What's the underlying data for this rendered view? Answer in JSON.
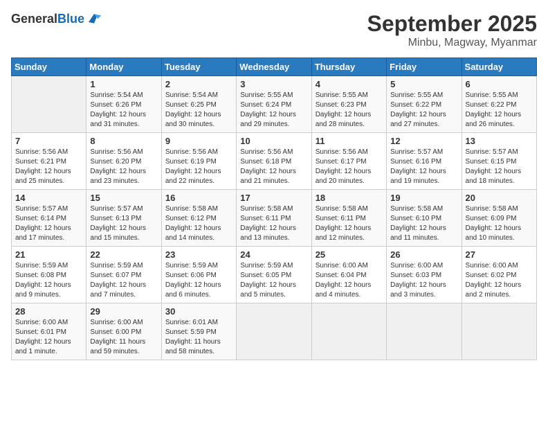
{
  "logo": {
    "general": "General",
    "blue": "Blue"
  },
  "title": "September 2025",
  "location": "Minbu, Magway, Myanmar",
  "weekdays": [
    "Sunday",
    "Monday",
    "Tuesday",
    "Wednesday",
    "Thursday",
    "Friday",
    "Saturday"
  ],
  "weeks": [
    [
      {
        "day": "",
        "info": ""
      },
      {
        "day": "1",
        "info": "Sunrise: 5:54 AM\nSunset: 6:26 PM\nDaylight: 12 hours\nand 31 minutes."
      },
      {
        "day": "2",
        "info": "Sunrise: 5:54 AM\nSunset: 6:25 PM\nDaylight: 12 hours\nand 30 minutes."
      },
      {
        "day": "3",
        "info": "Sunrise: 5:55 AM\nSunset: 6:24 PM\nDaylight: 12 hours\nand 29 minutes."
      },
      {
        "day": "4",
        "info": "Sunrise: 5:55 AM\nSunset: 6:23 PM\nDaylight: 12 hours\nand 28 minutes."
      },
      {
        "day": "5",
        "info": "Sunrise: 5:55 AM\nSunset: 6:22 PM\nDaylight: 12 hours\nand 27 minutes."
      },
      {
        "day": "6",
        "info": "Sunrise: 5:55 AM\nSunset: 6:22 PM\nDaylight: 12 hours\nand 26 minutes."
      }
    ],
    [
      {
        "day": "7",
        "info": "Sunrise: 5:56 AM\nSunset: 6:21 PM\nDaylight: 12 hours\nand 25 minutes."
      },
      {
        "day": "8",
        "info": "Sunrise: 5:56 AM\nSunset: 6:20 PM\nDaylight: 12 hours\nand 23 minutes."
      },
      {
        "day": "9",
        "info": "Sunrise: 5:56 AM\nSunset: 6:19 PM\nDaylight: 12 hours\nand 22 minutes."
      },
      {
        "day": "10",
        "info": "Sunrise: 5:56 AM\nSunset: 6:18 PM\nDaylight: 12 hours\nand 21 minutes."
      },
      {
        "day": "11",
        "info": "Sunrise: 5:56 AM\nSunset: 6:17 PM\nDaylight: 12 hours\nand 20 minutes."
      },
      {
        "day": "12",
        "info": "Sunrise: 5:57 AM\nSunset: 6:16 PM\nDaylight: 12 hours\nand 19 minutes."
      },
      {
        "day": "13",
        "info": "Sunrise: 5:57 AM\nSunset: 6:15 PM\nDaylight: 12 hours\nand 18 minutes."
      }
    ],
    [
      {
        "day": "14",
        "info": "Sunrise: 5:57 AM\nSunset: 6:14 PM\nDaylight: 12 hours\nand 17 minutes."
      },
      {
        "day": "15",
        "info": "Sunrise: 5:57 AM\nSunset: 6:13 PM\nDaylight: 12 hours\nand 15 minutes."
      },
      {
        "day": "16",
        "info": "Sunrise: 5:58 AM\nSunset: 6:12 PM\nDaylight: 12 hours\nand 14 minutes."
      },
      {
        "day": "17",
        "info": "Sunrise: 5:58 AM\nSunset: 6:11 PM\nDaylight: 12 hours\nand 13 minutes."
      },
      {
        "day": "18",
        "info": "Sunrise: 5:58 AM\nSunset: 6:11 PM\nDaylight: 12 hours\nand 12 minutes."
      },
      {
        "day": "19",
        "info": "Sunrise: 5:58 AM\nSunset: 6:10 PM\nDaylight: 12 hours\nand 11 minutes."
      },
      {
        "day": "20",
        "info": "Sunrise: 5:58 AM\nSunset: 6:09 PM\nDaylight: 12 hours\nand 10 minutes."
      }
    ],
    [
      {
        "day": "21",
        "info": "Sunrise: 5:59 AM\nSunset: 6:08 PM\nDaylight: 12 hours\nand 9 minutes."
      },
      {
        "day": "22",
        "info": "Sunrise: 5:59 AM\nSunset: 6:07 PM\nDaylight: 12 hours\nand 7 minutes."
      },
      {
        "day": "23",
        "info": "Sunrise: 5:59 AM\nSunset: 6:06 PM\nDaylight: 12 hours\nand 6 minutes."
      },
      {
        "day": "24",
        "info": "Sunrise: 5:59 AM\nSunset: 6:05 PM\nDaylight: 12 hours\nand 5 minutes."
      },
      {
        "day": "25",
        "info": "Sunrise: 6:00 AM\nSunset: 6:04 PM\nDaylight: 12 hours\nand 4 minutes."
      },
      {
        "day": "26",
        "info": "Sunrise: 6:00 AM\nSunset: 6:03 PM\nDaylight: 12 hours\nand 3 minutes."
      },
      {
        "day": "27",
        "info": "Sunrise: 6:00 AM\nSunset: 6:02 PM\nDaylight: 12 hours\nand 2 minutes."
      }
    ],
    [
      {
        "day": "28",
        "info": "Sunrise: 6:00 AM\nSunset: 6:01 PM\nDaylight: 12 hours\nand 1 minute."
      },
      {
        "day": "29",
        "info": "Sunrise: 6:00 AM\nSunset: 6:00 PM\nDaylight: 11 hours\nand 59 minutes."
      },
      {
        "day": "30",
        "info": "Sunrise: 6:01 AM\nSunset: 5:59 PM\nDaylight: 11 hours\nand 58 minutes."
      },
      {
        "day": "",
        "info": ""
      },
      {
        "day": "",
        "info": ""
      },
      {
        "day": "",
        "info": ""
      },
      {
        "day": "",
        "info": ""
      }
    ]
  ]
}
